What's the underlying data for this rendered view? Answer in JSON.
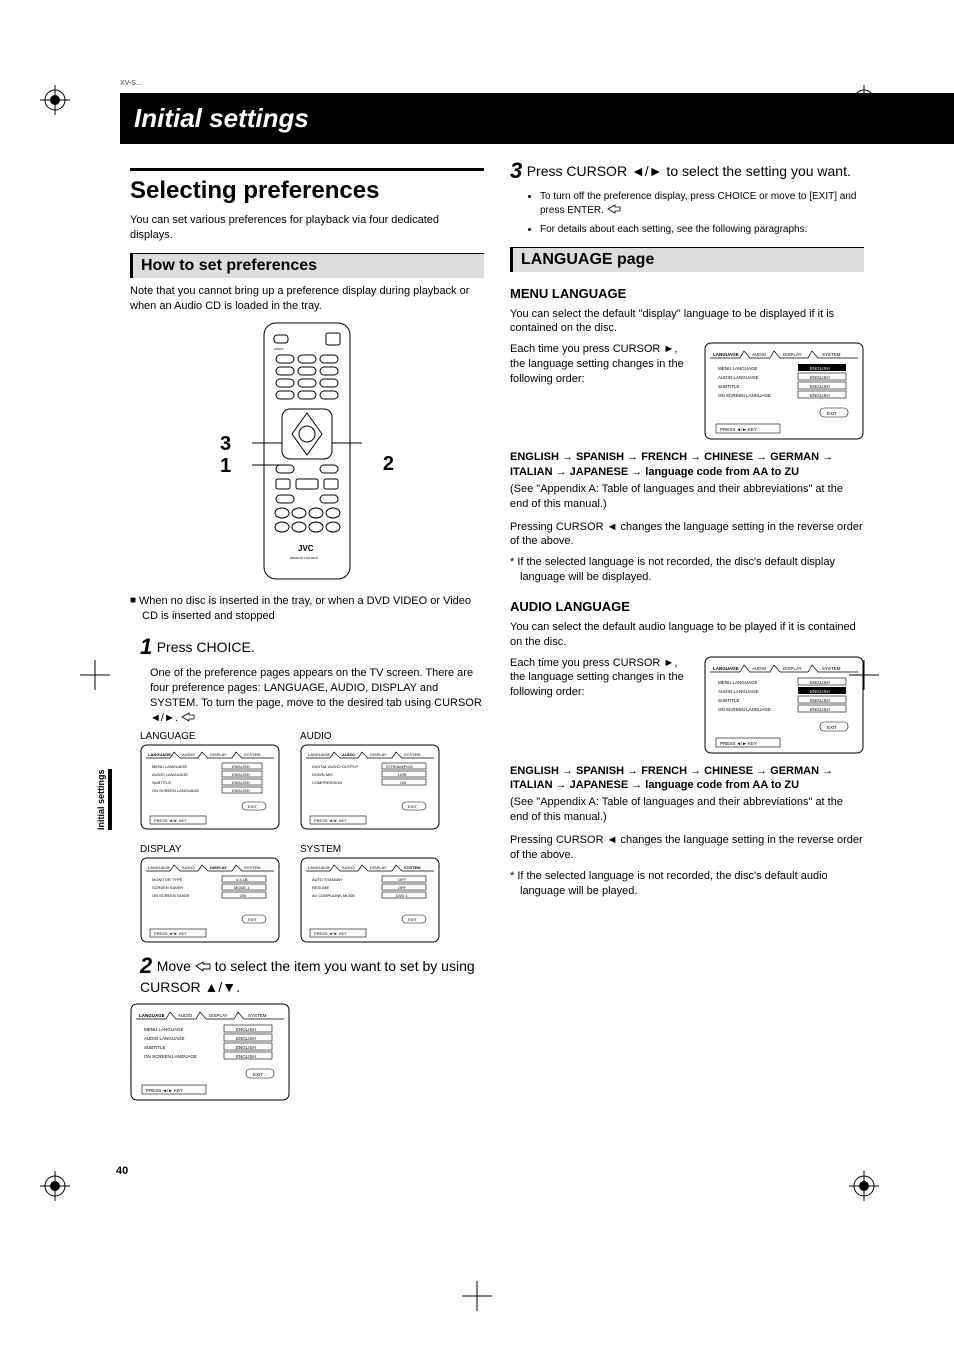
{
  "meta": {
    "header_line": "XV-S..."
  },
  "band": {
    "title": "Initial settings"
  },
  "side_tab": "Initial settings",
  "page_number": "40",
  "left": {
    "h2": "Selecting preferences",
    "intro": "You can set various preferences for playback via four dedicated displays.",
    "subhead": "How to set preferences",
    "note": "Note that you cannot bring up a preference display during playback or when an Audio CD is loaded in the tray.",
    "callouts": {
      "c1": "1",
      "c2": "2",
      "c3": "3"
    },
    "bullet_sq": "When no disc is inserted in the tray, or when a DVD VIDEO or Video CD is inserted and stopped",
    "step1": {
      "num": "1",
      "text": "Press CHOICE.",
      "desc": "One of the preference pages appears on the TV screen. There are four preference pages: LANGUAGE, AUDIO, DISPLAY and SYSTEM. To turn the page, move        to the desired tab using CURSOR ◄/►."
    },
    "screens": {
      "language": {
        "label": "LANGUAGE",
        "rows": [
          "MENU LANGUAGE",
          "AUDIO LANGUAGE",
          "SUBTITLE",
          "ON SCREEN LANGUAGE"
        ],
        "vals": [
          "ENGLISH",
          "ENGLISH",
          "ENGLISH",
          "ENGLISH"
        ]
      },
      "audio": {
        "label": "AUDIO",
        "rows": [
          "DIGITAL AUDIO OUTPUT",
          "DOWN MIX",
          "COMPRESSION"
        ],
        "vals": [
          "STREAM/PCM",
          "Lt/Rt",
          "ON"
        ]
      },
      "display": {
        "label": "DISPLAY",
        "rows": [
          "MONITOR TYPE",
          "SCREEN SAVER",
          "ON SCREEN GUIDE"
        ],
        "vals": [
          "4:3 LB",
          "MODE 1",
          "ON"
        ]
      },
      "system": {
        "label": "SYSTEM",
        "rows": [
          "AUTO STANDBY",
          "RESUME",
          "AV COMPULINK MODE"
        ],
        "vals": [
          "OFF",
          "OFF",
          "DVD 1"
        ]
      }
    },
    "step2": {
      "num": "2",
      "text_a": "Move ",
      "text_b": " to select the item you want to set by using CURSOR ▲/▼."
    },
    "osd_tabs": [
      "LANGUAGE",
      "AUDIO",
      "DISPLAY",
      "SYSTEM"
    ],
    "osd_exit": "EXIT",
    "osd_footer": "PRESS ◄/► KEY"
  },
  "right": {
    "step3": {
      "num": "3",
      "text": "Press CURSOR ◄/► to select the setting you want."
    },
    "bullets": [
      "To turn off the preference display, press CHOICE or move        to [EXIT] and press ENTER.",
      "For details about each setting, see the following paragraphs:"
    ],
    "langbar": "LANGUAGE page",
    "menu_lang": {
      "title": "MENU LANGUAGE",
      "p1": "You can select the default \"display\" language to be displayed if it is contained on the disc.",
      "p2": "Each time you press CURSOR ►, the language setting changes in the following order:",
      "chain": "ENGLISH → SPANISH → FRENCH → CHINESE → GERMAN → ITALIAN → JAPANESE → language code from AA to ZU",
      "see": "(See \"Appendix A: Table of languages and their abbreviations\" at the end of this manual.)",
      "rev": "Pressing CURSOR ◄ changes the language setting in the reverse order of the above.",
      "star": "* If the selected language is not recorded, the disc's default display language will be displayed."
    },
    "audio_lang": {
      "title": "AUDIO LANGUAGE",
      "p1": "You can select the default audio language to be played if it is contained on the disc.",
      "p2": "Each time you press CURSOR ►, the language setting changes in the following order:",
      "chain": "ENGLISH → SPANISH → FRENCH → CHINESE → GERMAN → ITALIAN → JAPANESE → language code from AA to ZU",
      "see": "(See \"Appendix A: Table of languages and their abbreviations\" at the end of this manual.)",
      "rev": "Pressing CURSOR ◄ changes the language setting in the reverse order of the above.",
      "star": "* If the selected language is not recorded, the disc's default audio language will be played."
    }
  }
}
